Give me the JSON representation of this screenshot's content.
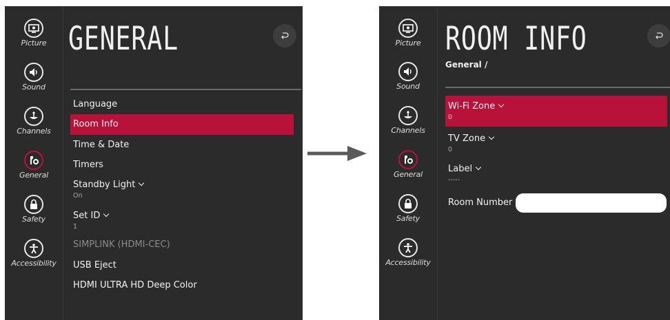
{
  "sidebar": {
    "items": [
      {
        "label": "Picture",
        "icon": "picture-icon"
      },
      {
        "label": "Sound",
        "icon": "sound-icon"
      },
      {
        "label": "Channels",
        "icon": "channels-icon"
      },
      {
        "label": "General",
        "icon": "general-icon"
      },
      {
        "label": "Safety",
        "icon": "safety-icon"
      },
      {
        "label": "Accessibility",
        "icon": "accessibility-icon"
      }
    ]
  },
  "left_panel": {
    "title": "GENERAL",
    "menu": [
      {
        "label": "Language"
      },
      {
        "label": "Room Info"
      },
      {
        "label": "Time & Date"
      },
      {
        "label": "Timers"
      },
      {
        "label": "Standby Light",
        "value": "On"
      },
      {
        "label": "Set ID",
        "value": "1"
      },
      {
        "label": "SIMPLINK (HDMI-CEC)"
      },
      {
        "label": "USB Eject"
      },
      {
        "label": "HDMI ULTRA HD Deep Color"
      }
    ]
  },
  "right_panel": {
    "title": "ROOM INFO",
    "breadcrumb": "General /",
    "menu": [
      {
        "label": "Wi-Fi Zone",
        "value": "0"
      },
      {
        "label": "TV Zone",
        "value": "0"
      },
      {
        "label": "Label",
        "value": "-----"
      },
      {
        "label": "Room Number",
        "value": ""
      }
    ]
  },
  "colors": {
    "accent": "#b8113a",
    "panel": "#2b2b2b",
    "arrow": "#5a5a5a"
  }
}
